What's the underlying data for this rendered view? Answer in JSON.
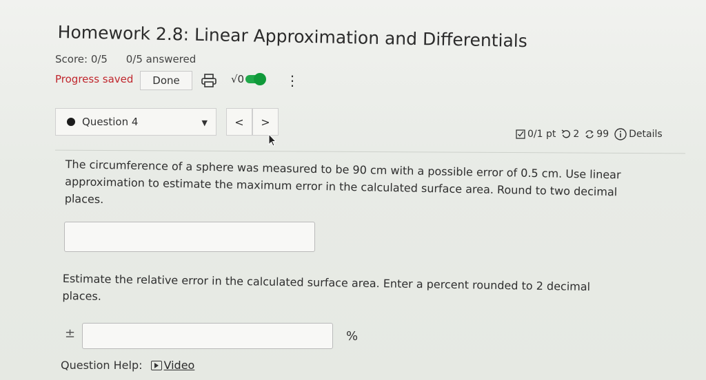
{
  "header": {
    "title": "Homework 2.8: Linear Approximation and Differentials",
    "score_label": "Score: 0/5",
    "answered_label": "0/5 answered",
    "progress_saved": "Progress saved",
    "done_label": "Done",
    "math_toggle_label": "√0"
  },
  "question_nav": {
    "current_label": "Question 4",
    "prev_symbol": "<",
    "next_symbol": ">"
  },
  "meta": {
    "points": "0/1 pt",
    "retries": "2",
    "attempts": "99",
    "details": "Details"
  },
  "question": {
    "prompt": "The circumference of a sphere was measured to be 90 cm with a possible error of 0.5 cm. Use linear approximation to estimate the maximum error in the calculated surface area. Round to two decimal places.",
    "answer1_value": "",
    "prompt2": "Estimate the relative error in the calculated surface area. Enter a percent rounded to 2 decimal places.",
    "plus_minus": "±",
    "answer2_value": "",
    "percent": "%"
  },
  "help": {
    "label": "Question Help:",
    "video": "Video"
  },
  "colors": {
    "saved_red": "#c0262d",
    "toggle_green": "#20a84a"
  }
}
